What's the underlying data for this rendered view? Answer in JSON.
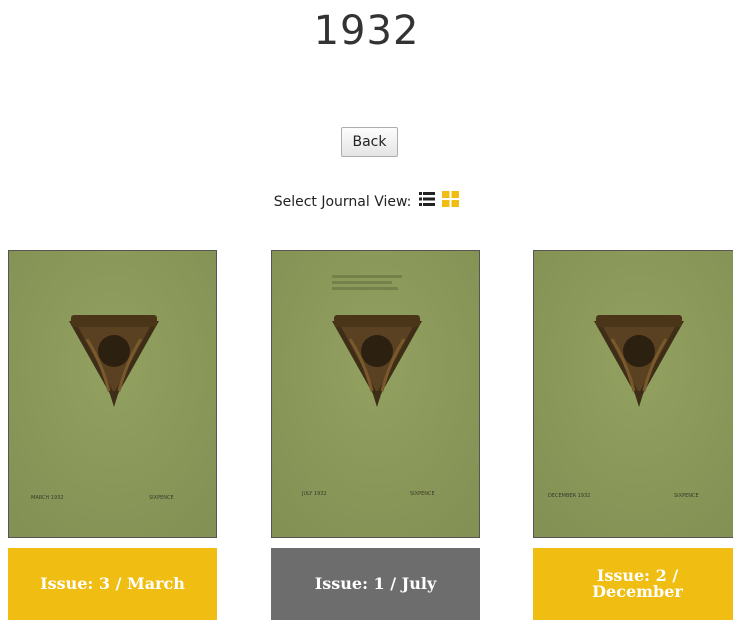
{
  "page": {
    "title": "1932",
    "back_label": "Back",
    "view_label": "Select Journal View:"
  },
  "view_icons": {
    "list": "list-view-icon",
    "grid": "grid-view-icon"
  },
  "colors": {
    "accent_yellow": "#f0be12",
    "selected_gray": "#6d6d6d",
    "cover_green": "#8e9c5d"
  },
  "issues": [
    {
      "label": "Issue: 3 / March",
      "cover_left_text": "MARCH 1932",
      "cover_right_text": "SIXPENCE"
    },
    {
      "label": "Issue: 1 / July",
      "cover_left_text": "JULY 1932",
      "cover_right_text": "SIXPENCE"
    },
    {
      "label": "Issue: 2 / December",
      "cover_left_text": "DECEMBER 1932",
      "cover_right_text": "SIXPENCE"
    }
  ]
}
